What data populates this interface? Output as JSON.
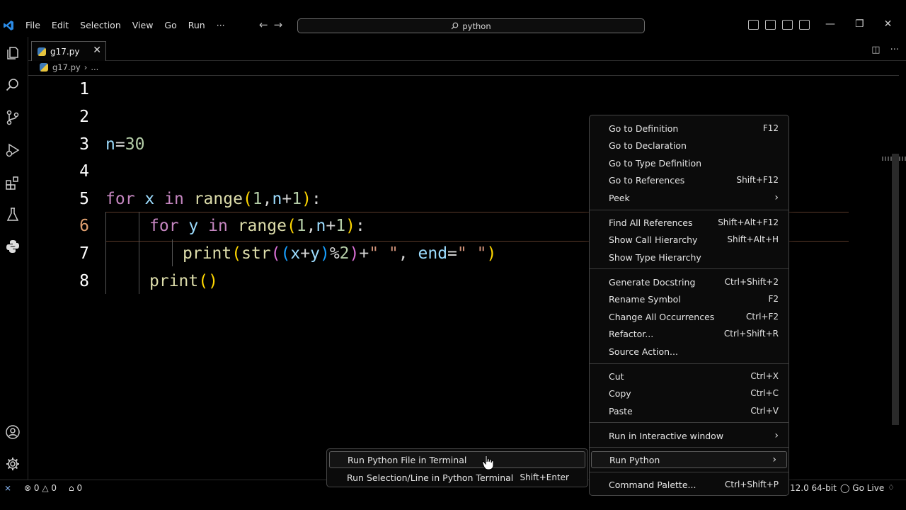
{
  "titlebar": {
    "menus": [
      "File",
      "Edit",
      "Selection",
      "View",
      "Go",
      "Run",
      "···"
    ],
    "back_icon": "←",
    "forward_icon": "→",
    "search_text": "python",
    "window_controls": [
      "—",
      "❐",
      "✕"
    ]
  },
  "activity_icons": [
    "explorer-icon",
    "search-icon",
    "source-control-icon",
    "run-debug-icon",
    "extensions-icon",
    "testing-icon",
    "python-icon",
    "account-icon",
    "settings-gear-icon"
  ],
  "tab": {
    "label": "g17.py",
    "close": "✕"
  },
  "breadcrumb": {
    "file": "g17.py",
    "sep": "›",
    "rest": "..."
  },
  "editor": {
    "line_numbers": [
      "1",
      "2",
      "3",
      "4",
      "5",
      "6",
      "7",
      "8"
    ],
    "code": {
      "l3": {
        "var": "n",
        "op": "=",
        "num": "30"
      },
      "l5": {
        "kw1": "for",
        "var": "x",
        "kw2": "in",
        "fn": "range",
        "open": "(",
        "num": "1",
        "comma": ",",
        "n": "n",
        "plus": "+",
        "one": "1",
        "close": ")",
        "colon": ":"
      },
      "l6": {
        "kw1": "for",
        "var": "y",
        "kw2": "in",
        "fn": "range",
        "open": "(",
        "num": "1",
        "comma": ",",
        "n": "n",
        "plus": "+",
        "one": "1",
        "close": ")",
        "colon": ":"
      },
      "l7": {
        "fn": "print",
        "o1": "(",
        "fn2": "str",
        "o2": "(",
        "o3": "(",
        "x": "x",
        "plus": "+",
        "y": "y",
        "c3": ")",
        "mod": "%",
        "two": "2",
        "c2": ")",
        "plus2": "+",
        "s1": "\" \"",
        "comma": ", ",
        "end": "end",
        "eq": "=",
        "s2": "\" \"",
        "c1": ")"
      },
      "l8": {
        "fn": "print",
        "paren": "()"
      }
    }
  },
  "context_menu": {
    "groups": [
      [
        {
          "label": "Go to Definition",
          "shortcut": "F12"
        },
        {
          "label": "Go to Declaration",
          "shortcut": ""
        },
        {
          "label": "Go to Type Definition",
          "shortcut": ""
        },
        {
          "label": "Go to References",
          "shortcut": "Shift+F12"
        },
        {
          "label": "Peek",
          "shortcut": "",
          "submenu": "›"
        }
      ],
      [
        {
          "label": "Find All References",
          "shortcut": "Shift+Alt+F12"
        },
        {
          "label": "Show Call Hierarchy",
          "shortcut": "Shift+Alt+H"
        },
        {
          "label": "Show Type Hierarchy",
          "shortcut": ""
        }
      ],
      [
        {
          "label": "Generate Docstring",
          "shortcut": "Ctrl+Shift+2"
        },
        {
          "label": "Rename Symbol",
          "shortcut": "F2"
        },
        {
          "label": "Change All Occurrences",
          "shortcut": "Ctrl+F2"
        },
        {
          "label": "Refactor...",
          "shortcut": "Ctrl+Shift+R"
        },
        {
          "label": "Source Action...",
          "shortcut": ""
        }
      ],
      [
        {
          "label": "Cut",
          "shortcut": "Ctrl+X"
        },
        {
          "label": "Copy",
          "shortcut": "Ctrl+C"
        },
        {
          "label": "Paste",
          "shortcut": "Ctrl+V"
        }
      ],
      [
        {
          "label": "Run in Interactive window",
          "shortcut": "",
          "submenu": "›"
        }
      ],
      [
        {
          "label": "Run Python",
          "shortcut": "",
          "submenu": "›",
          "highlighted": true
        }
      ],
      [
        {
          "label": "Command Palette...",
          "shortcut": "Ctrl+Shift+P"
        }
      ]
    ]
  },
  "submenu": {
    "items": [
      {
        "label": "Run Python File in Terminal",
        "shortcut": "",
        "highlighted": true
      },
      {
        "label": "Run Selection/Line in Python Terminal",
        "shortcut": "Shift+Enter"
      }
    ]
  },
  "statusbar": {
    "remote": "⨯",
    "errors": "0",
    "warnings": "0",
    "ports": "0",
    "python_version": "12.0 64-bit",
    "go_live": "Go Live",
    "bell": "🔔"
  },
  "colors": {
    "accent_blue": "#3d7ab8",
    "keyword": "#c586c0",
    "function": "#dcdcaa",
    "variable": "#9cdcfe",
    "number": "#b5cea8",
    "string": "#ce9178"
  }
}
